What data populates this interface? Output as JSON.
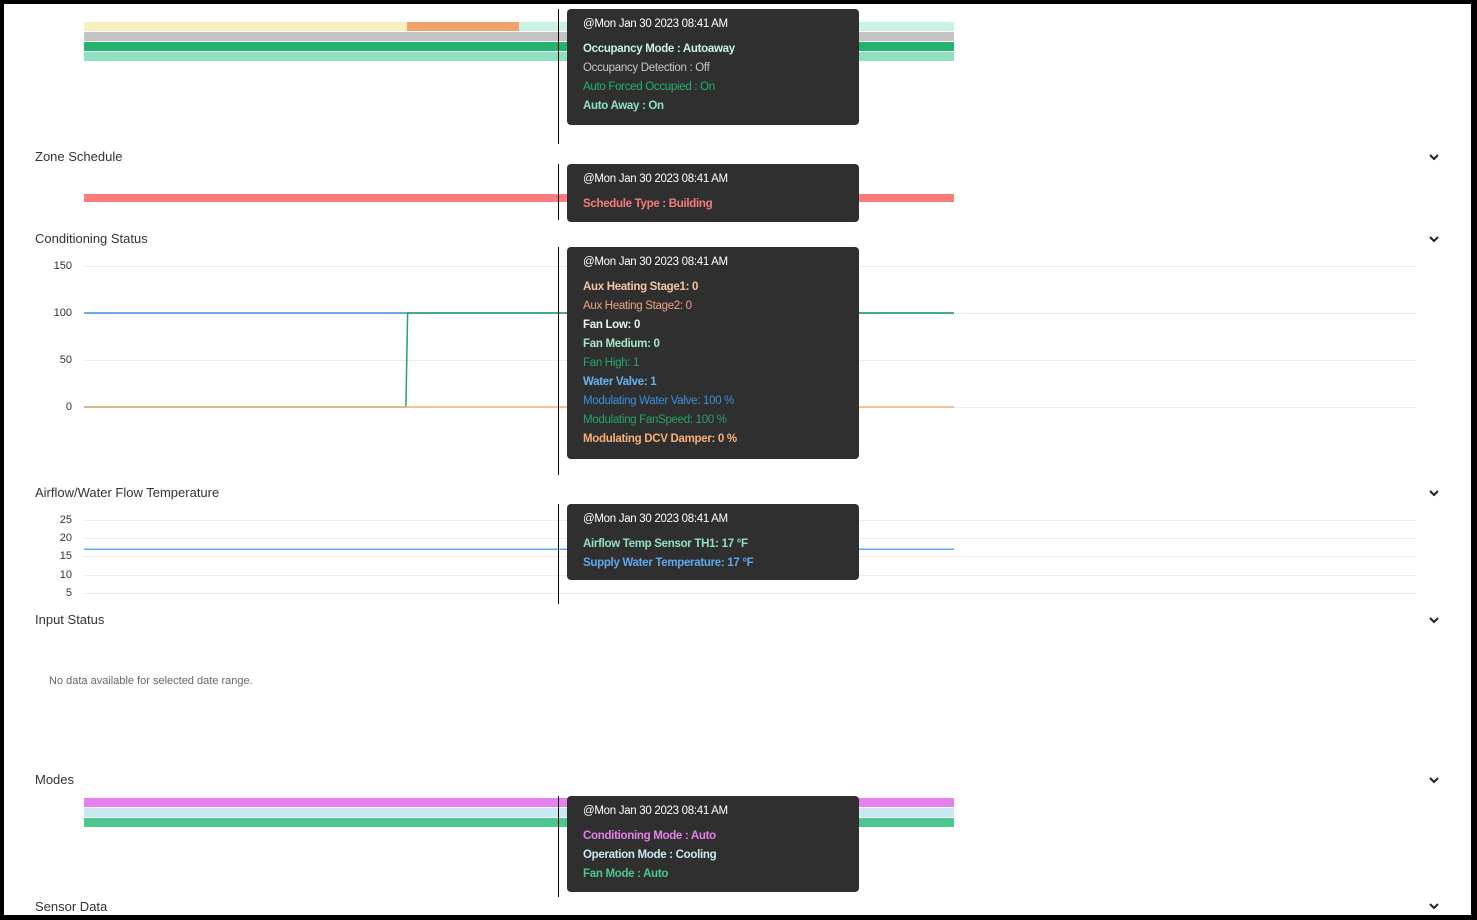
{
  "sections": {
    "zone_schedule": "Zone Schedule",
    "conditioning_status": "Conditioning Status",
    "airflow_temp": "Airflow/Water Flow Temperature",
    "input_status": "Input Status",
    "modes": "Modes",
    "sensor_data": "Sensor Data"
  },
  "icons": {
    "expand": "chevron-down-icon"
  },
  "input_status_empty": "No data available for selected date range.",
  "colors": {
    "tooltip_bg": "#2f2f2f",
    "occupancy_mode": "#c9f2e3",
    "occupancy_detection": "#c8c8c8",
    "auto_forced_occupied": "#24b26f",
    "auto_away": "#8fe0c0",
    "schedule_building": "#f87c7c",
    "aux_stage1": "#f2c6a7",
    "aux_stage2": "#f0a183",
    "fan_low": "#d8f2e8",
    "fan_medium": "#a3e8c8",
    "fan_high": "#26a96a",
    "water_valve": "#6ab3f1",
    "mod_water_valve": "#3a8fe0",
    "mod_fan_speed": "#27a36a",
    "mod_dcv": "#f7b07a",
    "airflow_temp": "#8fe0c0",
    "supply_water": "#5ea9ee",
    "conditioning_mode": "#e580ee",
    "operation_mode": "#c9e8f2",
    "fan_mode": "#4cc88e"
  },
  "tooltips": {
    "occupancy": {
      "timestamp": "@Mon Jan 30 2023 08:41 AM",
      "rows": [
        "Occupancy Mode : Autoaway",
        "Occupancy Detection : Off",
        "Auto Forced Occupied : On",
        "Auto Away : On"
      ]
    },
    "schedule": {
      "timestamp": "@Mon Jan 30 2023 08:41 AM",
      "rows": [
        "Schedule Type : Building"
      ]
    },
    "conditioning": {
      "timestamp": "@Mon Jan 30 2023 08:41 AM",
      "rows": [
        "Aux Heating Stage1: 0",
        "Aux Heating Stage2: 0",
        "Fan Low: 0",
        "Fan Medium: 0",
        "Fan High: 1",
        "Water Valve: 1",
        "Modulating Water Valve: 100 %",
        "Modulating FanSpeed: 100 %",
        "Modulating DCV Damper: 0 %"
      ]
    },
    "airflow": {
      "timestamp": "@Mon Jan 30 2023 08:41 AM",
      "rows": [
        "Airflow Temp Sensor TH1: 17 °F",
        "Supply Water Temperature: 17 °F"
      ]
    },
    "modes": {
      "timestamp": "@Mon Jan 30 2023 08:41 AM",
      "rows": [
        "Conditioning Mode : Auto",
        "Operation Mode : Cooling",
        "Fan Mode : Auto"
      ]
    }
  },
  "chart_data": [
    {
      "type": "line",
      "chart": "conditioning_status",
      "ylim": [
        0,
        150
      ],
      "yticks": [
        "150",
        "100",
        "50",
        "0"
      ],
      "series": [
        {
          "name": "Water Valve",
          "level": 100,
          "from": 0,
          "to": 1
        },
        {
          "name": "Modulating FanSpeed",
          "points": [
            [
              0,
              0
            ],
            [
              0.37,
              0
            ],
            [
              0.372,
              100
            ],
            [
              1,
              100
            ]
          ]
        },
        {
          "name": "Modulating DCV Damper",
          "level": 0,
          "from": 0,
          "to": 1
        }
      ]
    },
    {
      "type": "line",
      "chart": "airflow_temperature",
      "ylim": [
        5,
        25
      ],
      "yticks": [
        "25",
        "20",
        "15",
        "10",
        "5"
      ],
      "series": [
        {
          "name": "Supply Water Temperature",
          "level": 17,
          "from": 0,
          "to": 1
        }
      ]
    }
  ]
}
